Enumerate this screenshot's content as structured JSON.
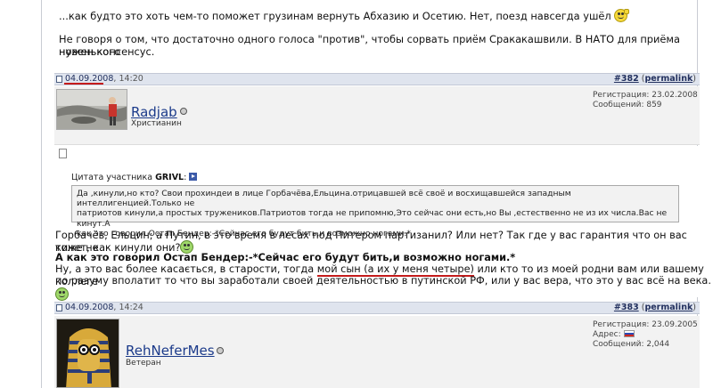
{
  "prev_post": {
    "line1": "...как будто это хоть чем-то поможет грузинам вернуть Абхазию и Осетию. Нет, поезд навсегда ушёл",
    "line2": "Не говоря о том, что достаточно одного голоса \"против\", чтобы сорвать приём Сракакашвили. В НАТО для приёма новенького",
    "line3": "нужен консенсус."
  },
  "post1": {
    "date": "04.09.2008",
    "time": ", 14:20",
    "number": "#382",
    "permalink": "permalink",
    "username": "Radjab",
    "usertitle": "Христианин",
    "reg_label": "Регистрация: 23.02.2008",
    "msgs_label": "Сообщений: 859",
    "quote_label_prefix": "Цитата участника ",
    "quote_author": "GRIVL",
    "quote_label_suffix": ":",
    "quote_line1": "Да ,кинули,но кто? Свои прохиндеи в лице Горбачёва,Ельцина.отрицавшей всё своё и восхищавшейся западным интеллигенцией.Только не",
    "quote_line2": "патриотов кинули,а простых тружеников.Патриотов тогда не припомню,Это сейчас они есть,но Вы ,естественно не из их числа.Вас не кинут.А",
    "quote_line3": "как это говорил Остап Бендер:-*Сейчас его будут бить,и возможно ногами.*",
    "body_line1": "Горбачёв, Ельцин; а Путин, в это время в лесах под Питером партизанил? Или нет? Так где у вас гарантия что он вас тоже не",
    "body_line2": "кинет, как кинули они?",
    "body_line3": "А как это говорил Остап Бендер:-*Сейчас его будут бить,и возможно ногами.*",
    "body_line4_a": "Ну, а это вас более касається, в старости, тогда ",
    "body_line4_b": "мой сын (а их у меня четыре)",
    "body_line4_c": " или кто то из моей родни вам или вашему коллеге",
    "body_line5": "по разуму вполатит то что вы заработали своей деятельностью в путинской РФ, или у вас вера, что это у вас всё на века."
  },
  "post2": {
    "date": "04.09.2008",
    "time": ", 14:24",
    "number": "#383",
    "permalink": "permalink",
    "username": "RehNeferMes",
    "usertitle": "Ветеран",
    "reg_label": "Регистрация: 23.09.2005",
    "addr_label": "Адрес:",
    "msgs_label": "Сообщений: 2,044"
  },
  "colors": {
    "header_bg": "#dfe4ee",
    "link": "#1b3a8a",
    "highlight_red": "#c41b1b"
  }
}
